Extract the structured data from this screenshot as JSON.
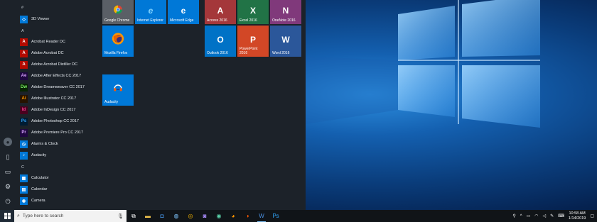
{
  "start_menu": {
    "sections": {
      "hash": "#",
      "a": "A",
      "c": "C"
    },
    "apps": [
      {
        "label": "3D Viewer",
        "icon": "cube-icon",
        "color": "#0078d7"
      },
      {
        "label": "Acrobat Reader DC",
        "icon": "acrobat-icon",
        "color": "#b30b00"
      },
      {
        "label": "Adobe Acrobat DC",
        "icon": "acrobat-icon",
        "color": "#b30b00"
      },
      {
        "label": "Adobe Acrobat Distiller DC",
        "icon": "acrobat-distiller-icon",
        "color": "#b30b00"
      },
      {
        "label": "Adobe After Effects CC 2017",
        "icon": "after-effects-icon",
        "color": "#1f0740"
      },
      {
        "label": "Adobe Dreamweaver CC 2017",
        "icon": "dreamweaver-icon",
        "color": "#072401"
      },
      {
        "label": "Adobe Illustrator CC 2017",
        "icon": "illustrator-icon",
        "color": "#261300"
      },
      {
        "label": "Adobe InDesign CC 2017",
        "icon": "indesign-icon",
        "color": "#49021f"
      },
      {
        "label": "Adobe Photoshop CC 2017",
        "icon": "photoshop-icon",
        "color": "#001c33"
      },
      {
        "label": "Adobe Premiere Pro CC 2017",
        "icon": "premiere-icon",
        "color": "#1f0740"
      },
      {
        "label": "Alarms & Clock",
        "icon": "alarm-clock-icon",
        "color": "#0078d7"
      },
      {
        "label": "Audacity",
        "icon": "audacity-icon",
        "color": "#0078d7"
      },
      {
        "label": "Calculator",
        "icon": "calculator-icon",
        "color": "#0078d7"
      },
      {
        "label": "Calendar",
        "icon": "calendar-icon",
        "color": "#0078d7"
      },
      {
        "label": "Camera",
        "icon": "camera-icon",
        "color": "#0078d7"
      }
    ],
    "tiles": [
      {
        "label": "Google Chrome",
        "icon": "chrome-icon",
        "color": "#5a5f66"
      },
      {
        "label": "Internet Explorer",
        "icon": "ie-icon",
        "color": "#0078d7"
      },
      {
        "label": "Microsoft Edge",
        "icon": "edge-icon",
        "color": "#0078d7"
      },
      {
        "label": "Mozilla Firefox",
        "icon": "firefox-icon",
        "color": "#0078d7"
      },
      {
        "label": "Audacity",
        "icon": "audacity-icon",
        "color": "#0078d7"
      },
      {
        "label": "Access 2016",
        "icon": "access-icon",
        "color": "#a4373a"
      },
      {
        "label": "Excel 2016",
        "icon": "excel-icon",
        "color": "#217346"
      },
      {
        "label": "OneNote 2016",
        "icon": "onenote-icon",
        "color": "#80397b"
      },
      {
        "label": "Outlook 2016",
        "icon": "outlook-icon",
        "color": "#0072c6"
      },
      {
        "label": "PowerPoint 2016",
        "icon": "powerpoint-icon",
        "color": "#d24726"
      },
      {
        "label": "Word 2016",
        "icon": "word-icon",
        "color": "#2b579a"
      }
    ]
  },
  "taskbar": {
    "search_placeholder": "Type here to search",
    "time": "10:58 AM",
    "date": "1/14/2019"
  }
}
